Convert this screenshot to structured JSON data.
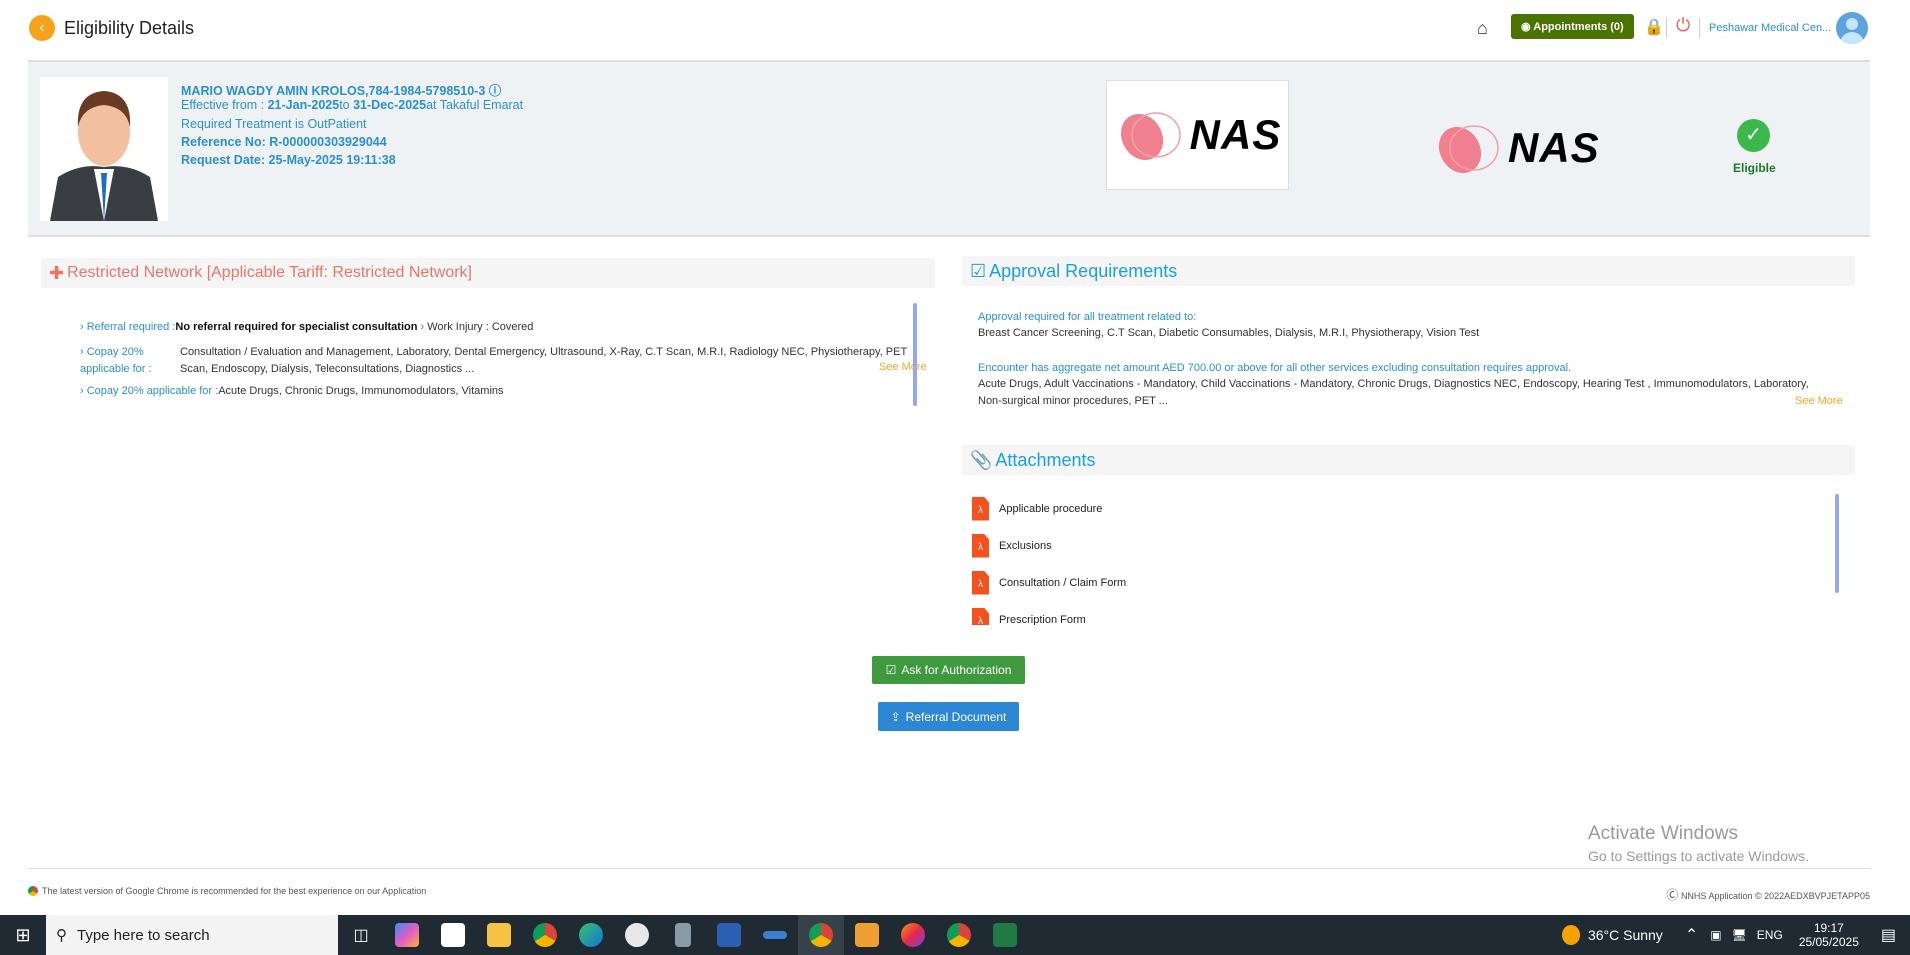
{
  "header": {
    "title": "Eligibility Details",
    "appointments_label": "Appointments (0)",
    "facility": "Peshawar Medical Cen..."
  },
  "patient": {
    "name_id": "MARIO WAGDY AMIN KROLOS,784-1984-5798510-3",
    "effective_prefix": "Effective from : ",
    "effective_from": "21-Jan-2025",
    "effective_to_prefix": "to ",
    "effective_to": "31-Dec-2025",
    "insurer_suffix": "at Takaful Emarat",
    "treatment": "Required Treatment is OutPatient",
    "reference": "Reference No: R-000000303929044",
    "request_date": "Request Date: 25-May-2025 19:11:38"
  },
  "payer": {
    "logo_text": "NAS",
    "tpa_logo_text": "NAS",
    "status": "Eligible"
  },
  "network": {
    "title": "Restricted Network [Applicable Tariff: Restricted Network]",
    "referral_label": "Referral required :",
    "referral_value": "No referral required for specialist consultation",
    "work_injury": "Work Injury : Covered",
    "copay1_label": "Copay 20% applicable for :",
    "copay1_value": "Consultation / Evaluation and Management, Laboratory, Dental Emergency, Ultrasound, X-Ray, C.T Scan, M.R.I, Radiology NEC, Physiotherapy, PET Scan, Endoscopy, Dialysis, Teleconsultations, Diagnostics ...",
    "see_more": "See More",
    "copay2_label": "Copay 20% applicable for :",
    "copay2_value": "Acute Drugs, Chronic Drugs, Immunomodulators, Vitamins"
  },
  "approval": {
    "title": "Approval Requirements",
    "heading1": "Approval required for all treatment related to:",
    "items1": "Breast Cancer Screening, C.T Scan, Diabetic Consumables, Dialysis, M.R.I, Physiotherapy, Vision Test",
    "heading2": "Encounter has aggregate net amount AED 700.00 or above for all other services excluding consultation requires approval.",
    "items2": "Acute Drugs, Adult Vaccinations - Mandatory, Child Vaccinations - Mandatory, Chronic Drugs, Diagnostics NEC, Endoscopy, Hearing Test , Immunomodulators, Laboratory, Non-surgical minor procedures, PET ...",
    "see_more": "See More"
  },
  "attachments": {
    "title": "Attachments",
    "items": [
      "Applicable procedure",
      "Exclusions",
      "Consultation / Claim Form",
      "Prescription Form"
    ]
  },
  "actions": {
    "ask_auth": "Ask for Authorization",
    "referral_doc": "Referral Document"
  },
  "footer": {
    "browser_note": "The latest version of Google Chrome is recommended for the best experience on our Application",
    "copyright": "NNHS Application © 2022AEDXBVPJETAPP05"
  },
  "watermark": {
    "line1": "Activate Windows",
    "line2": "Go to Settings to activate Windows."
  },
  "taskbar": {
    "search_placeholder": "Type here to search",
    "weather": "36°C  Sunny",
    "lang": "ENG",
    "time": "19:17",
    "date": "25/05/2025"
  }
}
